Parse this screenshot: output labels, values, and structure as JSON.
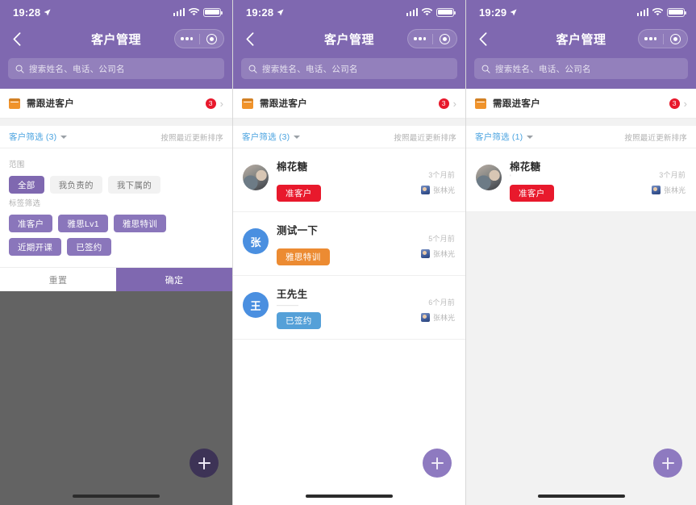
{
  "screens": [
    {
      "id": "filter-panel",
      "status": {
        "time": "19:28",
        "location_icon": "location-arrow-icon",
        "signal_icon": "signal-bars-icon",
        "wifi_icon": "wifi-icon",
        "battery_icon": "battery-full-icon"
      },
      "nav": {
        "back_icon": "back-chevron-icon",
        "title": "客户管理",
        "menu_icon": "more-dots-icon",
        "target_icon": "target-circle-icon"
      },
      "search": {
        "icon": "search-icon",
        "placeholder": "搜索姓名、电话、公司名",
        "value": ""
      },
      "follow_row": {
        "icon": "folder-icon",
        "label": "需跟进客户",
        "badge": "3",
        "chevron": "chevron-right-icon"
      },
      "filter_head": {
        "label": "客户筛选 (3)",
        "caret_icon": "chevron-down-icon",
        "sort_label": "按照最近更新排序"
      },
      "panel": {
        "scope_label": "范围",
        "scope_chips": [
          {
            "label": "全部",
            "selected": true
          },
          {
            "label": "我负责的",
            "selected": false
          },
          {
            "label": "我下属的",
            "selected": false
          }
        ],
        "tag_label": "标签筛选",
        "tag_chips": [
          {
            "label": "准客户",
            "selected": true
          },
          {
            "label": "雅思Lv1",
            "selected": true
          },
          {
            "label": "雅思特训",
            "selected": true
          },
          {
            "label": "近期开课",
            "selected": true
          },
          {
            "label": "已签约",
            "selected": true
          }
        ],
        "reset_label": "重置",
        "confirm_label": "确定"
      },
      "fab": {
        "icon": "plus-icon",
        "dimmed": true
      },
      "list": []
    },
    {
      "id": "customer-list-3",
      "status": {
        "time": "19:28",
        "location_icon": "location-arrow-icon",
        "signal_icon": "signal-bars-icon",
        "wifi_icon": "wifi-icon",
        "battery_icon": "battery-full-icon"
      },
      "nav": {
        "back_icon": "back-chevron-icon",
        "title": "客户管理",
        "menu_icon": "more-dots-icon",
        "target_icon": "target-circle-icon"
      },
      "search": {
        "icon": "search-icon",
        "placeholder": "搜索姓名、电话、公司名",
        "value": ""
      },
      "follow_row": {
        "icon": "folder-icon",
        "label": "需跟进客户",
        "badge": "3",
        "chevron": "chevron-right-icon"
      },
      "filter_head": {
        "label": "客户筛选 (3)",
        "caret_icon": "chevron-down-icon",
        "sort_label": "按照最近更新排序"
      },
      "fab": {
        "icon": "plus-icon",
        "dimmed": false
      },
      "list": [
        {
          "name": "棉花糖",
          "sub": "",
          "tag": "准客户",
          "tag_color": "#e8192c",
          "avatar_type": "photo",
          "avatar_initial": "",
          "time": "3个月前",
          "owner": "张林光"
        },
        {
          "name": "测试一下",
          "sub": "",
          "tag": "雅思特训",
          "tag_color": "#ec8b32",
          "avatar_type": "blue",
          "avatar_initial": "张",
          "time": "5个月前",
          "owner": "张林光"
        },
        {
          "name": "王先生",
          "sub": "———",
          "tag": "已签约",
          "tag_color": "#55a0d8",
          "avatar_type": "blue",
          "avatar_initial": "王",
          "time": "6个月前",
          "owner": "张林光"
        }
      ]
    },
    {
      "id": "customer-list-1",
      "status": {
        "time": "19:29",
        "location_icon": "location-arrow-icon",
        "signal_icon": "signal-bars-icon",
        "wifi_icon": "wifi-icon",
        "battery_icon": "battery-full-icon"
      },
      "nav": {
        "back_icon": "back-chevron-icon",
        "title": "客户管理",
        "menu_icon": "more-dots-icon",
        "target_icon": "target-circle-icon"
      },
      "search": {
        "icon": "search-icon",
        "placeholder": "搜索姓名、电话、公司名",
        "value": ""
      },
      "follow_row": {
        "icon": "folder-icon",
        "label": "需跟进客户",
        "badge": "3",
        "chevron": "chevron-right-icon"
      },
      "filter_head": {
        "label": "客户筛选 (1)",
        "caret_icon": "chevron-down-icon",
        "sort_label": "按照最近更新排序"
      },
      "fab": {
        "icon": "plus-icon",
        "dimmed": false
      },
      "list": [
        {
          "name": "棉花糖",
          "sub": "'",
          "tag": "准客户",
          "tag_color": "#e8192c",
          "avatar_type": "photo",
          "avatar_initial": "",
          "time": "3个月前",
          "owner": "张林光"
        }
      ]
    }
  ],
  "colors": {
    "brand_purple": "#7f68b0",
    "chip_purple": "#8a76bb",
    "link_blue": "#4aa3e0",
    "badge_red": "#e8192c",
    "tag_orange": "#ec8b32",
    "tag_blue": "#55a0d8",
    "dim_overlay": "#636363"
  }
}
